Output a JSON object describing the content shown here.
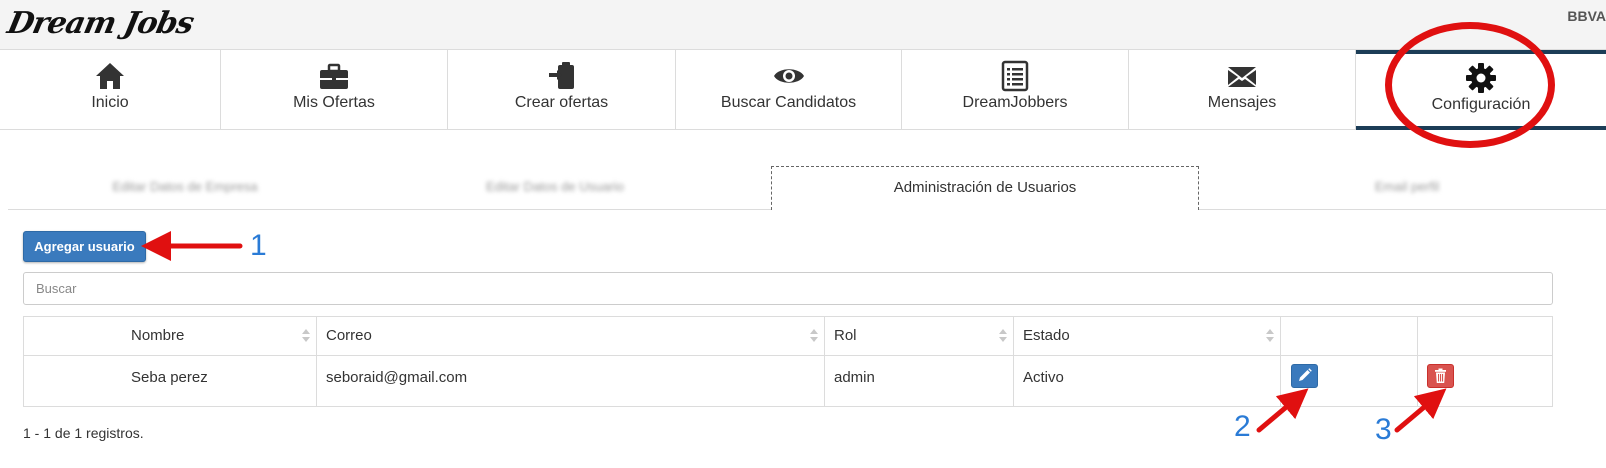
{
  "header": {
    "logo": "Dream Jobs",
    "company": "BBVA"
  },
  "nav": {
    "items": [
      {
        "label": "Inicio",
        "icon": "home-icon"
      },
      {
        "label": "Mis Ofertas",
        "icon": "briefcase-icon"
      },
      {
        "label": "Crear ofertas",
        "icon": "clipboard-icon"
      },
      {
        "label": "Buscar Candidatos",
        "icon": "eye-icon"
      },
      {
        "label": "DreamJobbers",
        "icon": "list-icon"
      },
      {
        "label": "Mensajes",
        "icon": "envelope-icon"
      },
      {
        "label": "Configuración",
        "icon": "gear-icon",
        "active": true
      }
    ]
  },
  "subtabs": [
    {
      "label": "Editar Datos de Empresa"
    },
    {
      "label": "Editar Datos de Usuario"
    },
    {
      "label": "Administración de Usuarios",
      "active": true
    },
    {
      "label": "Email perfil"
    }
  ],
  "toolbar": {
    "add_label": "Agregar usuario"
  },
  "search": {
    "placeholder": "Buscar"
  },
  "table": {
    "columns": [
      "Nombre",
      "Correo",
      "Rol",
      "Estado"
    ],
    "rows": [
      {
        "nombre": "Seba perez",
        "correo": "seboraid@gmail.com",
        "rol": "admin",
        "estado": "Activo"
      }
    ]
  },
  "footer": {
    "records": "1 - 1 de 1 registros."
  },
  "annotations": {
    "n1": "1",
    "n2": "2",
    "n3": "3"
  },
  "colors": {
    "primary": "#3a7abd",
    "danger": "#d9534f",
    "nav_active": "#1c3d57",
    "annotation_red": "#e01010",
    "annotation_blue": "#2a7bd6"
  }
}
